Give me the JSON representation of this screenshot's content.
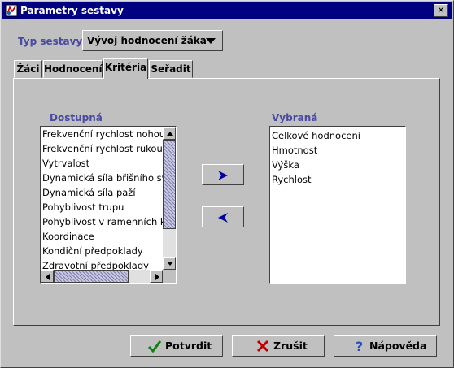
{
  "window": {
    "title": "Parametry sestavy"
  },
  "report_type": {
    "label": "Typ sestavy",
    "value": "Vývoj hodnocení žáka"
  },
  "tabs": [
    {
      "label": "Žáci"
    },
    {
      "label": "Hodnocení"
    },
    {
      "label": "Kritéria"
    },
    {
      "label": "Seřadit"
    }
  ],
  "active_tab": "Kritéria",
  "available": {
    "label": "Dostupná",
    "items": [
      "Frekvenční rychlost nohou",
      "Frekvenční rychlost rukou",
      "Vytrvalost",
      "Dynamická síla břišního svalstva",
      "Dynamická síla paží",
      "Pohyblivost trupu",
      "Pohyblivost v ramenních kloubech",
      "Koordinace",
      "Kondiční předpoklady",
      "Zdravotní předpoklady"
    ]
  },
  "selected": {
    "label": "Vybraná",
    "items": [
      "Celkové hodnocení",
      "Hmotnost",
      "Výška",
      "Rychlost"
    ]
  },
  "buttons": {
    "confirm": "Potvrdit",
    "cancel": "Zrušit",
    "help": "Nápověda"
  },
  "colors": {
    "accent_text": "#4a4aa0",
    "title_bar": "#000080",
    "arrow": "#0000a0"
  },
  "icons": {
    "confirm": "checkmark-icon",
    "cancel": "x-icon",
    "help": "question-icon",
    "add": "arrow-right-icon",
    "remove": "arrow-left-icon"
  }
}
